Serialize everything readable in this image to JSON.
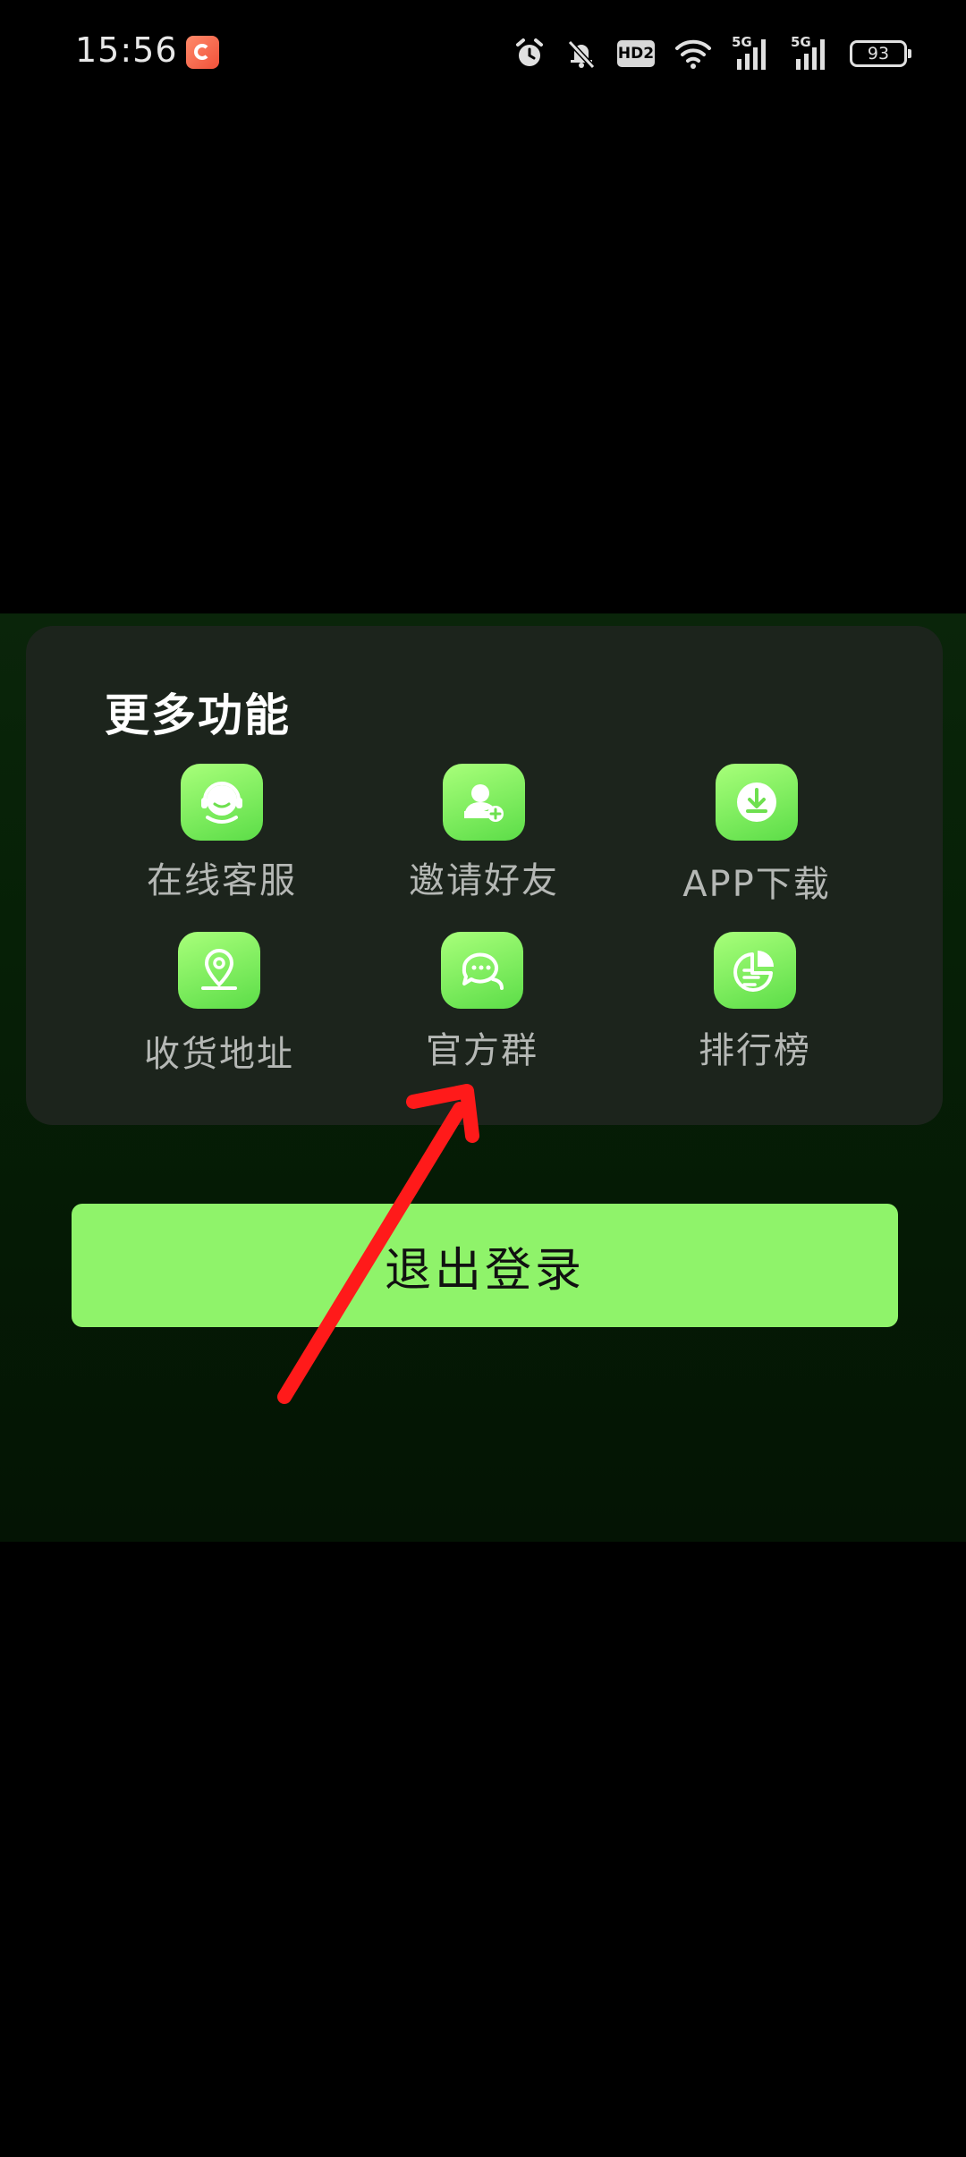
{
  "status_bar": {
    "time": "15:56",
    "hd_label": "HD2",
    "network_label_1": "5G",
    "network_label_2": "5G",
    "battery": "93"
  },
  "more_features": {
    "title": "更多功能",
    "items": [
      {
        "label": "在线客服",
        "icon": "customer-service-icon"
      },
      {
        "label": "邀请好友",
        "icon": "invite-friend-icon"
      },
      {
        "label": "APP下载",
        "icon": "download-icon"
      },
      {
        "label": "收货地址",
        "icon": "location-pin-icon"
      },
      {
        "label": "官方群",
        "icon": "chat-group-icon"
      },
      {
        "label": "排行榜",
        "icon": "ranking-chart-icon"
      }
    ]
  },
  "logout": {
    "label": "退出登录"
  },
  "colors": {
    "accent_green": "#8ff36a",
    "annotation_red": "#ff1a1a"
  }
}
